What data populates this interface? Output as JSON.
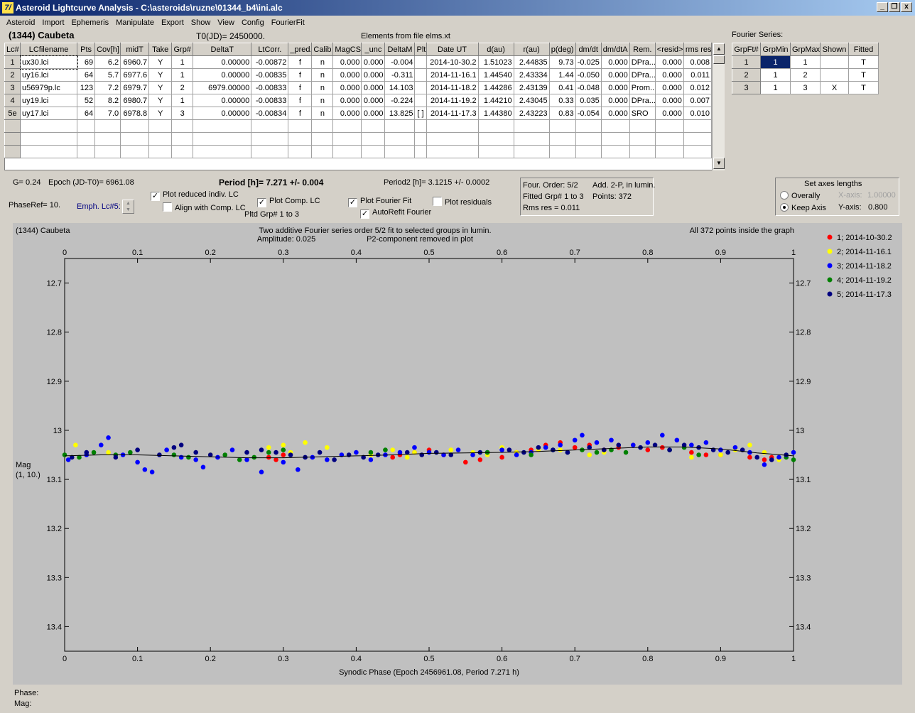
{
  "window": {
    "title": "Asteroid Lightcurve Analysis - C:\\asteroids\\ruzne\\01344_b4\\ini.alc",
    "icon_text": "7/",
    "minimize": "_",
    "restore": "❐",
    "close": "x"
  },
  "menu": [
    "Asteroid",
    "Import",
    "Ephemeris",
    "Manipulate",
    "Export",
    "Show",
    "View",
    "Config",
    "FourierFit"
  ],
  "header": {
    "asteroid": "(1344) Caubeta",
    "t0": "T0(JD)= 2450000.",
    "elements": "Elements from file elms.xt",
    "fourier_title": "Fourier Series:"
  },
  "lc_table": {
    "columns": [
      "Lc#",
      "LCfilename",
      "Pts",
      "Cov[h]",
      "midT",
      "Take",
      "Grp#",
      "DeltaT",
      "LtCorr.",
      "_pred.",
      "Calib",
      "MagCS",
      "_unc",
      "DeltaM",
      "Plt",
      "Date UT",
      "d(au)",
      "r(au)",
      "p(deg)",
      "dm/dt",
      "dm/dtA",
      "Rem.",
      "<resid>",
      "rms res"
    ],
    "rows": [
      [
        "1",
        "ux30.lci",
        "69",
        "6.2",
        "6960.7",
        "Y",
        "1",
        "0.00000",
        "-0.00872",
        "f",
        "n",
        "0.000",
        "0.000",
        "-0.004",
        "",
        "2014-10-30.2",
        "1.51023",
        "2.44835",
        "9.73",
        "-0.025",
        "0.000",
        "DPra...",
        "0.000",
        "0.008"
      ],
      [
        "2",
        "uy16.lci",
        "64",
        "5.7",
        "6977.6",
        "Y",
        "1",
        "0.00000",
        "-0.00835",
        "f",
        "n",
        "0.000",
        "0.000",
        "-0.311",
        "",
        "2014-11-16.1",
        "1.44540",
        "2.43334",
        "1.44",
        "-0.050",
        "0.000",
        "DPra...",
        "0.000",
        "0.011"
      ],
      [
        "3",
        "u56979p.lc",
        "123",
        "7.2",
        "6979.7",
        "Y",
        "2",
        "6979.00000",
        "-0.00833",
        "f",
        "n",
        "0.000",
        "0.000",
        "14.103",
        "",
        "2014-11-18.2",
        "1.44286",
        "2.43139",
        "0.41",
        "-0.048",
        "0.000",
        "Prom...",
        "0.000",
        "0.012"
      ],
      [
        "4",
        "uy19.lci",
        "52",
        "8.2",
        "6980.7",
        "Y",
        "1",
        "0.00000",
        "-0.00833",
        "f",
        "n",
        "0.000",
        "0.000",
        "-0.224",
        "",
        "2014-11-19.2",
        "1.44210",
        "2.43045",
        "0.33",
        "0.035",
        "0.000",
        "DPra...",
        "0.000",
        "0.007"
      ],
      [
        "5e",
        "uy17.lci",
        "64",
        "7.0",
        "6978.8",
        "Y",
        "3",
        "0.00000",
        "-0.00834",
        "f",
        "n",
        "0.000",
        "0.000",
        "13.825",
        "[ ]",
        "2014-11-17.3",
        "1.44380",
        "2.43223",
        "0.83",
        "-0.054",
        "0.000",
        "SRO",
        "0.000",
        "0.010"
      ]
    ]
  },
  "fourier_table": {
    "columns": [
      "GrpFt#",
      "GrpMin",
      "GrpMax",
      "Shown",
      "Fitted"
    ],
    "rows": [
      [
        "1",
        "1",
        "1",
        "",
        "T"
      ],
      [
        "2",
        "1",
        "2",
        "",
        "T"
      ],
      [
        "3",
        "1",
        "3",
        "X",
        "T"
      ]
    ]
  },
  "info": {
    "g": "G= 0.24",
    "epoch": "Epoch (JD-T0)= 6961.08",
    "period": "Period [h]= 7.271 +/- 0.004",
    "period2": "Period2 [h]= 3.1215 +/- 0.0002",
    "phaseref": "PhaseRef= 10.",
    "emph": "Emph. Lc#5:",
    "plot_reduced": "Plot reduced indiv. LC",
    "align_comp": "Align with Comp. LC",
    "plot_comp": "Plot Comp. LC",
    "pltd_grp": "Pltd Grp#  1   to   3",
    "plot_fourier": "Plot Fourier Fit",
    "autorefit": "AutoRefit Fourier",
    "plot_residuals": "Plot residuals",
    "check_mark": "✓"
  },
  "fit_panel": {
    "order": "Four. Order:  5/2",
    "add": "Add. 2-P, in lumin.",
    "fitted": "Fitted Grp# 1 to 3",
    "points": "Points: 372",
    "rms": "Rms res     = 0.011"
  },
  "axes_panel": {
    "title": "Set axes lengths",
    "overally": "Overally",
    "keep": "Keep Axis",
    "xaxis_label": "X-axis:",
    "xaxis_value": "1.00000",
    "yaxis_label": "Y-axis:",
    "yaxis_value": "0.800"
  },
  "plot": {
    "name": "(1344) Caubeta",
    "subtitle1": "Two additive Fourier series order 5/2 fit to selected groups in lumin.",
    "amplitude": "Amplitude: 0.025",
    "p2": "P2-component removed in plot",
    "inside": "All 372 points inside the graph",
    "ylabel1": "Mag",
    "ylabel2": "(1, 10.)",
    "xlabel": "Synodic Phase (Epoch 2456961.08, Period 7.271 h)"
  },
  "status": {
    "phase": "Phase:",
    "mag": "Mag:"
  },
  "chart_data": {
    "type": "scatter",
    "title": "Two additive Fourier series order 5/2 fit to selected groups in lumin.",
    "xlabel": "Synodic Phase (Epoch 2456961.08, Period 7.271 h)",
    "ylabel": "Mag",
    "xlim": [
      0.0,
      1.0
    ],
    "ylim": [
      12.65,
      13.45
    ],
    "y_inverted": true,
    "x_ticks": [
      0.0,
      0.1,
      0.2,
      0.3,
      0.4,
      0.5,
      0.6,
      0.7,
      0.8,
      0.9,
      1.0
    ],
    "y_ticks": [
      12.7,
      12.8,
      12.9,
      13.0,
      13.1,
      13.2,
      13.3,
      13.4
    ],
    "legend_position": "right",
    "series": [
      {
        "name": "1; 2014-10-30.2",
        "color": "#ff0000",
        "points": [
          [
            0.28,
            13.055
          ],
          [
            0.29,
            13.06
          ],
          [
            0.3,
            13.05
          ],
          [
            0.45,
            13.055
          ],
          [
            0.46,
            13.05
          ],
          [
            0.48,
            13.045
          ],
          [
            0.5,
            13.04
          ],
          [
            0.52,
            13.05
          ],
          [
            0.55,
            13.065
          ],
          [
            0.57,
            13.06
          ],
          [
            0.6,
            13.055
          ],
          [
            0.62,
            13.045
          ],
          [
            0.64,
            13.04
          ],
          [
            0.66,
            13.03
          ],
          [
            0.68,
            13.025
          ],
          [
            0.7,
            13.035
          ],
          [
            0.72,
            13.03
          ],
          [
            0.74,
            13.04
          ],
          [
            0.76,
            13.035
          ],
          [
            0.78,
            13.03
          ],
          [
            0.8,
            13.04
          ],
          [
            0.82,
            13.035
          ],
          [
            0.86,
            13.045
          ],
          [
            0.88,
            13.05
          ],
          [
            0.9,
            13.05
          ],
          [
            0.94,
            13.055
          ],
          [
            0.96,
            13.06
          ],
          [
            0.97,
            13.055
          ]
        ]
      },
      {
        "name": "2; 2014-11-16.1",
        "color": "#ffff00",
        "points": [
          [
            0.015,
            13.03
          ],
          [
            0.06,
            13.045
          ],
          [
            0.2,
            13.05
          ],
          [
            0.28,
            13.035
          ],
          [
            0.3,
            13.03
          ],
          [
            0.31,
            13.045
          ],
          [
            0.33,
            13.025
          ],
          [
            0.36,
            13.035
          ],
          [
            0.42,
            13.05
          ],
          [
            0.45,
            13.04
          ],
          [
            0.47,
            13.055
          ],
          [
            0.48,
            13.045
          ],
          [
            0.53,
            13.04
          ],
          [
            0.56,
            13.045
          ],
          [
            0.58,
            13.05
          ],
          [
            0.6,
            13.035
          ],
          [
            0.62,
            13.045
          ],
          [
            0.65,
            13.04
          ],
          [
            0.68,
            13.04
          ],
          [
            0.72,
            13.05
          ],
          [
            0.74,
            13.045
          ],
          [
            0.78,
            13.03
          ],
          [
            0.86,
            13.055
          ],
          [
            0.9,
            13.05
          ],
          [
            0.92,
            13.04
          ],
          [
            0.94,
            13.03
          ],
          [
            0.96,
            13.045
          ],
          [
            0.98,
            13.06
          ]
        ]
      },
      {
        "name": "3; 2014-11-18.2",
        "color": "#0000ff",
        "points": [
          [
            0.005,
            13.06
          ],
          [
            0.03,
            13.05
          ],
          [
            0.05,
            13.03
          ],
          [
            0.06,
            13.015
          ],
          [
            0.08,
            13.05
          ],
          [
            0.1,
            13.065
          ],
          [
            0.11,
            13.08
          ],
          [
            0.12,
            13.085
          ],
          [
            0.14,
            13.04
          ],
          [
            0.16,
            13.055
          ],
          [
            0.18,
            13.06
          ],
          [
            0.19,
            13.075
          ],
          [
            0.21,
            13.055
          ],
          [
            0.23,
            13.04
          ],
          [
            0.25,
            13.06
          ],
          [
            0.27,
            13.085
          ],
          [
            0.3,
            13.065
          ],
          [
            0.32,
            13.08
          ],
          [
            0.34,
            13.055
          ],
          [
            0.36,
            13.06
          ],
          [
            0.38,
            13.05
          ],
          [
            0.4,
            13.045
          ],
          [
            0.42,
            13.06
          ],
          [
            0.44,
            13.05
          ],
          [
            0.46,
            13.045
          ],
          [
            0.48,
            13.035
          ],
          [
            0.5,
            13.045
          ],
          [
            0.52,
            13.05
          ],
          [
            0.54,
            13.04
          ],
          [
            0.56,
            13.05
          ],
          [
            0.58,
            13.045
          ],
          [
            0.6,
            13.04
          ],
          [
            0.62,
            13.05
          ],
          [
            0.64,
            13.045
          ],
          [
            0.66,
            13.035
          ],
          [
            0.68,
            13.03
          ],
          [
            0.7,
            13.02
          ],
          [
            0.71,
            13.01
          ],
          [
            0.73,
            13.025
          ],
          [
            0.75,
            13.02
          ],
          [
            0.78,
            13.03
          ],
          [
            0.8,
            13.025
          ],
          [
            0.82,
            13.01
          ],
          [
            0.84,
            13.02
          ],
          [
            0.86,
            13.03
          ],
          [
            0.88,
            13.025
          ],
          [
            0.9,
            13.04
          ],
          [
            0.92,
            13.035
          ],
          [
            0.94,
            13.045
          ],
          [
            0.96,
            13.07
          ],
          [
            0.98,
            13.055
          ],
          [
            1.0,
            13.045
          ]
        ]
      },
      {
        "name": "4; 2014-11-19.2",
        "color": "#008000",
        "points": [
          [
            0.0,
            13.05
          ],
          [
            0.02,
            13.055
          ],
          [
            0.04,
            13.045
          ],
          [
            0.07,
            13.05
          ],
          [
            0.09,
            13.045
          ],
          [
            0.15,
            13.05
          ],
          [
            0.17,
            13.055
          ],
          [
            0.22,
            13.05
          ],
          [
            0.24,
            13.06
          ],
          [
            0.26,
            13.055
          ],
          [
            0.28,
            13.045
          ],
          [
            0.3,
            13.04
          ],
          [
            0.42,
            13.045
          ],
          [
            0.44,
            13.04
          ],
          [
            0.58,
            13.045
          ],
          [
            0.64,
            13.05
          ],
          [
            0.67,
            13.04
          ],
          [
            0.69,
            13.045
          ],
          [
            0.71,
            13.04
          ],
          [
            0.73,
            13.045
          ],
          [
            0.75,
            13.04
          ],
          [
            0.77,
            13.045
          ],
          [
            0.83,
            13.04
          ],
          [
            0.85,
            13.035
          ],
          [
            0.87,
            13.05
          ],
          [
            0.99,
            13.055
          ],
          [
            1.0,
            13.06
          ]
        ]
      },
      {
        "name": "5; 2014-11-17.3",
        "color": "#000080",
        "points": [
          [
            0.01,
            13.055
          ],
          [
            0.03,
            13.045
          ],
          [
            0.07,
            13.055
          ],
          [
            0.1,
            13.04
          ],
          [
            0.13,
            13.05
          ],
          [
            0.15,
            13.035
          ],
          [
            0.16,
            13.03
          ],
          [
            0.18,
            13.045
          ],
          [
            0.2,
            13.05
          ],
          [
            0.25,
            13.045
          ],
          [
            0.27,
            13.04
          ],
          [
            0.29,
            13.045
          ],
          [
            0.31,
            13.05
          ],
          [
            0.33,
            13.055
          ],
          [
            0.35,
            13.045
          ],
          [
            0.37,
            13.06
          ],
          [
            0.39,
            13.05
          ],
          [
            0.41,
            13.055
          ],
          [
            0.43,
            13.05
          ],
          [
            0.47,
            13.045
          ],
          [
            0.49,
            13.05
          ],
          [
            0.51,
            13.045
          ],
          [
            0.53,
            13.05
          ],
          [
            0.57,
            13.045
          ],
          [
            0.61,
            13.04
          ],
          [
            0.63,
            13.045
          ],
          [
            0.65,
            13.035
          ],
          [
            0.67,
            13.04
          ],
          [
            0.69,
            13.045
          ],
          [
            0.72,
            13.035
          ],
          [
            0.74,
            13.04
          ],
          [
            0.76,
            13.03
          ],
          [
            0.79,
            13.035
          ],
          [
            0.81,
            13.03
          ],
          [
            0.83,
            13.04
          ],
          [
            0.85,
            13.03
          ],
          [
            0.87,
            13.035
          ],
          [
            0.89,
            13.04
          ],
          [
            0.91,
            13.045
          ],
          [
            0.93,
            13.04
          ],
          [
            0.95,
            13.055
          ],
          [
            0.97,
            13.06
          ],
          [
            0.99,
            13.05
          ]
        ]
      }
    ],
    "fit_curve": [
      [
        0.0,
        13.052
      ],
      [
        0.05,
        13.05
      ],
      [
        0.1,
        13.05
      ],
      [
        0.15,
        13.052
      ],
      [
        0.2,
        13.054
      ],
      [
        0.25,
        13.056
      ],
      [
        0.3,
        13.056
      ],
      [
        0.35,
        13.054
      ],
      [
        0.4,
        13.052
      ],
      [
        0.45,
        13.05
      ],
      [
        0.5,
        13.047
      ],
      [
        0.55,
        13.046
      ],
      [
        0.6,
        13.045
      ],
      [
        0.65,
        13.043
      ],
      [
        0.7,
        13.04
      ],
      [
        0.75,
        13.037
      ],
      [
        0.8,
        13.034
      ],
      [
        0.85,
        13.034
      ],
      [
        0.9,
        13.038
      ],
      [
        0.95,
        13.046
      ],
      [
        1.0,
        13.052
      ]
    ]
  }
}
